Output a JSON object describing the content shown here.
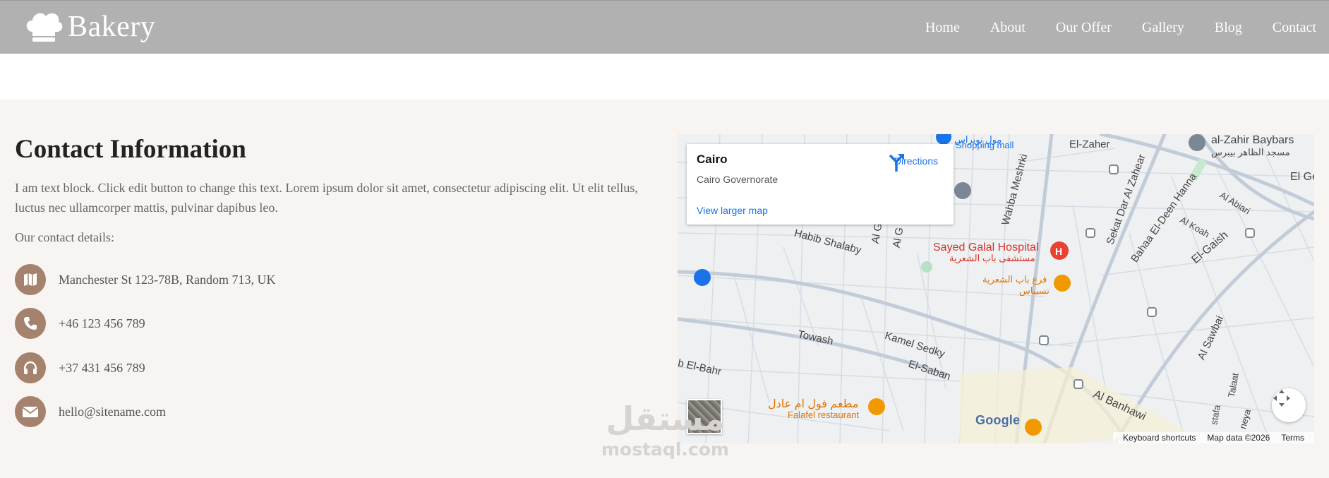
{
  "header": {
    "logo_text": "Bakery",
    "nav": [
      "Home",
      "About",
      "Our Offer",
      "Gallery",
      "Blog",
      "Contact"
    ]
  },
  "contact": {
    "title": "Contact Information",
    "paragraph": "I am text block. Click edit button to change this text. Lorem ipsum dolor sit amet, consectetur adipiscing elit. Ut elit tellus, luctus nec ullamcorper mattis, pulvinar dapibus leo.",
    "details_label": "Our contact details:",
    "items": [
      {
        "icon": "map-icon",
        "text": "Manchester St 123-78B, Random 713, UK"
      },
      {
        "icon": "phone-icon",
        "text": "+46 123 456 789"
      },
      {
        "icon": "headphones-icon",
        "text": "+37 431 456 789"
      },
      {
        "icon": "envelope-icon",
        "text": "hello@sitename.com"
      }
    ]
  },
  "map": {
    "place_name": "Cairo",
    "place_region": "Cairo Governorate",
    "directions_label": "Directions",
    "larger_map_label": "View larger map",
    "google_label": "Google",
    "footer": [
      "Keyboard shortcuts",
      "Map data ©2026",
      "Terms"
    ],
    "labels": {
      "mall_ar": "مول نوبراس",
      "mall": "Shopping mall",
      "el_zaher": "El-Zaher",
      "baybars": "al-Zahir Baybars",
      "baybars_ar": "مسجد الظاهر بيبرس",
      "el_ge": "El Ge",
      "habib": "Habib Shalaby",
      "hospital": "Sayed Galal Hospital",
      "hospital_ar": "مستشفى باب الشعرية",
      "bab_ar": "فرع باب الشعرية",
      "bab_ar2": "تسيباس",
      "towash": "Towash",
      "kamel": "Kamel Sedky",
      "saban": "El-Saban",
      "bahr": "b El-Bahr",
      "falafel_ar": "مطعم فول ام عادل",
      "falafel": "Falafel restaurant",
      "sekat": "Sekat Dar Al Zahear",
      "bahaa": "Bahaa El-Deen Hanna",
      "wahba": "Wahba Meshrki",
      "koah": "Al Koah",
      "abiari": "Al Abiari",
      "gaish": "El-Gaish",
      "sawbai": "Al Sawbai",
      "banhawi": "Al Banhawi",
      "talaat": "Talaat",
      "mostafa": "stafa",
      "neya": "neya",
      "ag1": "Al G",
      "ag2": "Al G"
    }
  },
  "watermark": {
    "arabic": "مستقل",
    "latin": "mostaql.com"
  },
  "colors": {
    "header": "#b1b1b1",
    "accent": "#a5826d",
    "section": "#f8f4f2",
    "link": "#1a73e8"
  }
}
